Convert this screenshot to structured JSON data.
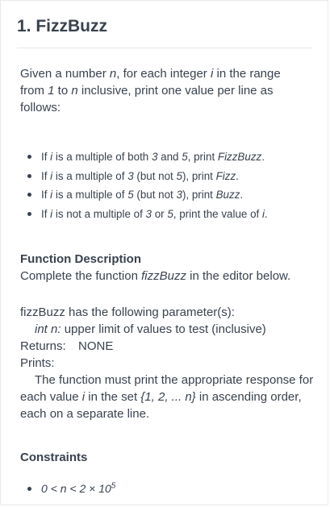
{
  "problem": {
    "title": "1. FizzBuzz",
    "intro": {
      "t1": "Given a number ",
      "n": "n",
      "t2": ", for each integer ",
      "i": "i",
      "t3": " in the range from ",
      "one": "1",
      "t4": " to ",
      "n2": "n",
      "t5": " inclusive, print one value per line as follows:"
    },
    "rules": [
      {
        "a": "If ",
        "i": "i",
        "b": " is a multiple of both ",
        "x": "3",
        "c": " and ",
        "y": "5",
        "d": ", print ",
        "out": "FizzBuzz",
        "e": "."
      },
      {
        "a": "If ",
        "i": "i",
        "b": " is a multiple of ",
        "x": "3",
        "c": " (but not ",
        "y": "5",
        "d": "), print ",
        "out": "Fizz",
        "e": "."
      },
      {
        "a": "If ",
        "i": "i",
        "b": " is a multiple of ",
        "x": "5",
        "c": " (but not ",
        "y": "3",
        "d": "), print ",
        "out": "Buzz",
        "e": "."
      },
      {
        "a": "If ",
        "i": "i",
        "b": " is not a multiple of ",
        "x": "3",
        "c": " or ",
        "y": "5",
        "d": ", print the value of ",
        "out": "i",
        "e": "."
      }
    ],
    "function_description": {
      "heading": "Function Description",
      "t1": "Complete the function ",
      "fn": "fizzBuzz",
      "t2": " in the editor below."
    },
    "parameters": {
      "intro": "fizzBuzz has the following parameter(s):",
      "param_type": "int n:",
      "param_desc": " upper limit of values to test (inclusive)",
      "returns_label": "Returns:",
      "returns_value": "NONE",
      "prints_label": "Prints:",
      "prints_t1": "The function must print the appropriate response for each value ",
      "prints_i": "i",
      "prints_t2": " in the set ",
      "prints_set": "{1, 2, ... n}",
      "prints_t3": " in ascending order, each on a separate line."
    },
    "constraints": {
      "heading": "Constraints",
      "item_base": "0 < n < 2 × 10",
      "item_exp": "5"
    }
  }
}
